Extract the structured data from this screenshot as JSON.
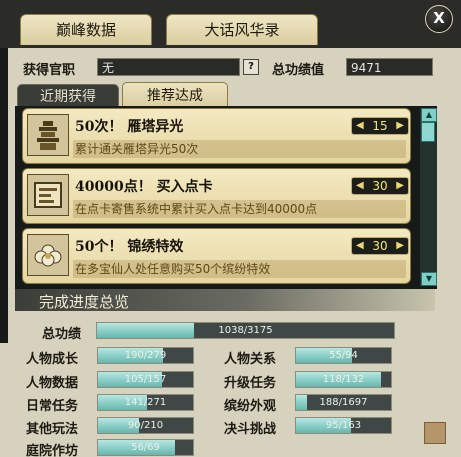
{
  "tabs": [
    {
      "label": "巅峰数据"
    },
    {
      "label": "大话风华录"
    }
  ],
  "close_label": "X",
  "info": {
    "title_label": "获得官职",
    "title_value": "无",
    "help": "?",
    "merit_label": "总功绩值",
    "merit_value": "9471"
  },
  "subtabs": [
    {
      "label": "近期获得",
      "active": false
    },
    {
      "label": "推荐达成",
      "active": true
    }
  ],
  "achievements": [
    {
      "title": "50次！ 雁塔异光",
      "desc": "累计通关雁塔异光50次",
      "points": "15",
      "icon": "pagoda-icon"
    },
    {
      "title": "40000点！ 买入点卡",
      "desc": "在点卡寄售系统中累计买入点卡达到40000点",
      "points": "30",
      "icon": "card-icon"
    },
    {
      "title": "50个！ 锦绣特效",
      "desc": "在多宝仙人处任意购买50个缤纷特效",
      "points": "30",
      "icon": "flower-icon"
    }
  ],
  "progress": {
    "header": "完成进度总览",
    "total": {
      "label": "总功绩",
      "text": "1038/3175",
      "value": 1038,
      "max": 3175
    },
    "items": [
      {
        "label": "人物成长",
        "text": "190/279",
        "value": 190,
        "max": 279
      },
      {
        "label": "人物关系",
        "text": "55/94",
        "value": 55,
        "max": 94
      },
      {
        "label": "人物数据",
        "text": "105/157",
        "value": 105,
        "max": 157
      },
      {
        "label": "升级任务",
        "text": "118/132",
        "value": 118,
        "max": 132
      },
      {
        "label": "日常任务",
        "text": "141/271",
        "value": 141,
        "max": 271
      },
      {
        "label": "缤纷外观",
        "text": "188/1697",
        "value": 188,
        "max": 1697
      },
      {
        "label": "其他玩法",
        "text": "90/210",
        "value": 90,
        "max": 210
      },
      {
        "label": "决斗挑战",
        "text": "95/163",
        "value": 95,
        "max": 163
      },
      {
        "label": "庭院作坊",
        "text": "56/69",
        "value": 56,
        "max": 69
      }
    ]
  }
}
